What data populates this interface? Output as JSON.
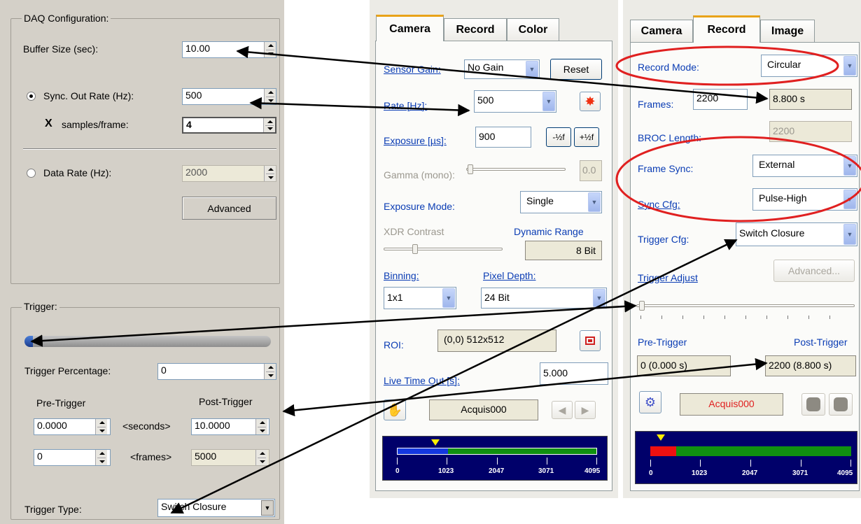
{
  "left": {
    "daq": {
      "title": "DAQ Configuration:",
      "buffer_label": "Buffer Size (sec):",
      "buffer_value": "10.00",
      "sync_label": "Sync. Out Rate (Hz):",
      "sync_value": "500",
      "x_mark": "X",
      "spf_label": "samples/frame:",
      "spf_value": "4",
      "data_rate_label": "Data Rate (Hz):",
      "data_rate_value": "2000",
      "advanced_label": "Advanced"
    },
    "trigger": {
      "title": "Trigger:",
      "percent_label": "Trigger Percentage:",
      "percent_value": "0",
      "pre_label": "Pre-Trigger",
      "post_label": "Post-Trigger",
      "pre_seconds": "0.0000",
      "seconds_label": "<seconds>",
      "post_seconds": "10.0000",
      "pre_frames": "0",
      "frames_label": "<frames>",
      "post_frames": "5000",
      "type_label": "Trigger Type:",
      "type_value": "Switch Closure"
    }
  },
  "camera_panel": {
    "tabs": [
      "Camera",
      "Record",
      "Color"
    ],
    "sensor_gain_label": "Sensor Gain:",
    "sensor_gain_value": "No Gain",
    "reset_label": "Reset",
    "rate_label": "Rate [Hz]:",
    "rate_value": "500",
    "exposure_label": "Exposure [µs]:",
    "exposure_value": "900",
    "half_minus": "-½f",
    "half_plus": "+½f",
    "gamma_label": "Gamma (mono):",
    "gamma_value": "0.0",
    "exposure_mode_label": "Exposure Mode:",
    "exposure_mode_value": "Single",
    "xdr_label": "XDR Contrast",
    "dynamic_range_label": "Dynamic Range",
    "dynamic_range_value": "8 Bit",
    "binning_label": "Binning:",
    "binning_value": "1x1",
    "pixel_depth_label": "Pixel Depth:",
    "pixel_depth_value": "24 Bit",
    "roi_label": "ROI:",
    "roi_value": "(0,0) 512x512",
    "live_timeout_label": "Live Time Out [s]:",
    "live_timeout_value": "5.000",
    "acquis_value": "Acquis000",
    "meter_ticks": [
      "0",
      "1023",
      "2047",
      "3071",
      "4095"
    ]
  },
  "record_panel": {
    "tabs": [
      "Camera",
      "Record",
      "Image"
    ],
    "record_mode_label": "Record Mode:",
    "record_mode_value": "Circular",
    "frames_label": "Frames:",
    "frames_value": "2200",
    "frames_time": "8.800 s",
    "broc_label": "BROC Length:",
    "broc_value": "2200",
    "frame_sync_label": "Frame Sync:",
    "frame_sync_value": "External",
    "sync_cfg_label": "Sync Cfg:",
    "sync_cfg_value": "Pulse-High",
    "trigger_cfg_label": "Trigger Cfg:",
    "trigger_cfg_value": "Switch Closure",
    "trigger_adjust_label": "Trigger Adjust",
    "advanced_label": "Advanced...",
    "pre_label": "Pre-Trigger",
    "post_label": "Post-Trigger",
    "pre_value": "0 (0.000 s)",
    "post_value": "2200 (8.800 s)",
    "acquis_value": "Acquis000",
    "meter_ticks": [
      "0",
      "1023",
      "2047",
      "3071",
      "4095"
    ]
  },
  "colors": {
    "accent_red": "#e02020",
    "label_blue": "#0a3cb4",
    "meter_bg": "#00006a",
    "meter_green": "#109010"
  }
}
